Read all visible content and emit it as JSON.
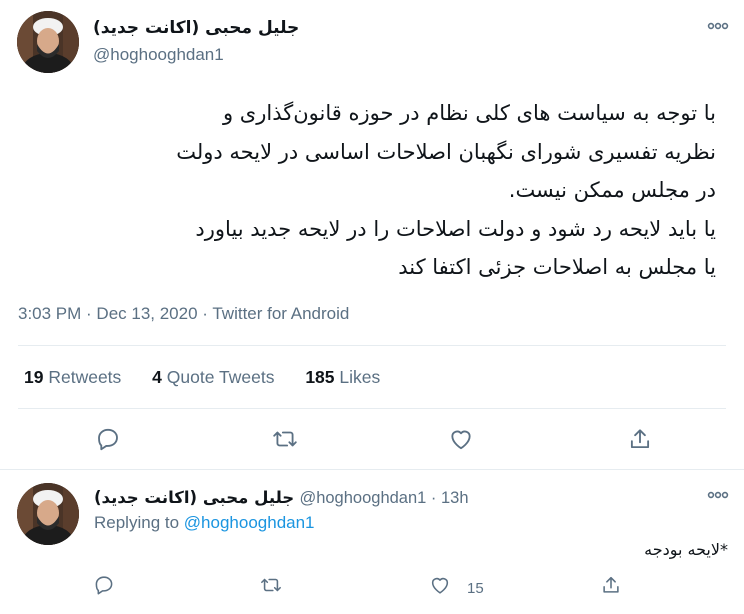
{
  "main_tweet": {
    "author_name": "جلیل محبی (اکانت جدید)",
    "handle": "@hoghooghdan1",
    "body": "با توجه به سیاست های کلی نظام در حوزه قانون‌گذاری و\nنظریه تفسیری شورای نگهبان اصلاحات اساسی در لایحه دولت\nدر مجلس ممکن نیست.\nیا باید لایحه رد شود و دولت اصلاحات را در لایحه جدید بیاورد\nیا مجلس به اصلاحات جزئی اکتفا کند",
    "timestamp": "3:03 PM · Dec 13, 2020 · Twitter for Android",
    "stats": {
      "retweets_count": "19",
      "retweets_label": "Retweets",
      "quotes_count": "4",
      "quotes_label": "Quote Tweets",
      "likes_count": "185",
      "likes_label": "Likes"
    },
    "actions": [
      "reply-icon",
      "retweet-icon",
      "like-icon",
      "share-icon"
    ]
  },
  "reply_tweet": {
    "author_name": "جلیل محبی (اکانت جدید)",
    "handle_time": "@hoghooghdan1 · 13h",
    "replying_prefix": "Replying to",
    "replying_handle": "@hoghooghdan1",
    "text": "*لایحه بودجه",
    "like_count": "15",
    "actions": [
      "reply-icon",
      "retweet-icon",
      "like-icon",
      "share-icon"
    ]
  },
  "colors": {
    "text": "#0f1419",
    "secondary": "#5b7083",
    "link": "#1b95e0",
    "divider": "#e6ecf0"
  }
}
